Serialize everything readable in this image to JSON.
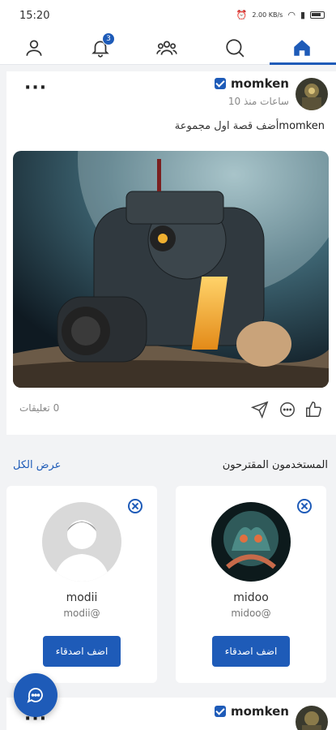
{
  "status_bar": {
    "time": "15:20",
    "speed": "2.00\nKB/s",
    "speed_text": "2.00 KB/s"
  },
  "nav": {
    "notification_count": "3"
  },
  "post": {
    "username": "momken",
    "timestamp": "10 ساعات منذ",
    "text_user": "momken",
    "text_action": "أضف قصة اول مجموعة",
    "comments": "0 تعليقات"
  },
  "suggestions": {
    "title": "المستخدمون المقترحون",
    "see_all": "عرض الكل",
    "users": [
      {
        "name": "midoo",
        "handle": "midoo@",
        "button": "اضف اصدقاء"
      },
      {
        "name": "modii",
        "handle": "modii@",
        "button": "اضف اصدقاء"
      }
    ]
  },
  "post2": {
    "username": "momken"
  },
  "colors": {
    "accent": "#1e5bb8",
    "background": "#f2f3f5"
  }
}
